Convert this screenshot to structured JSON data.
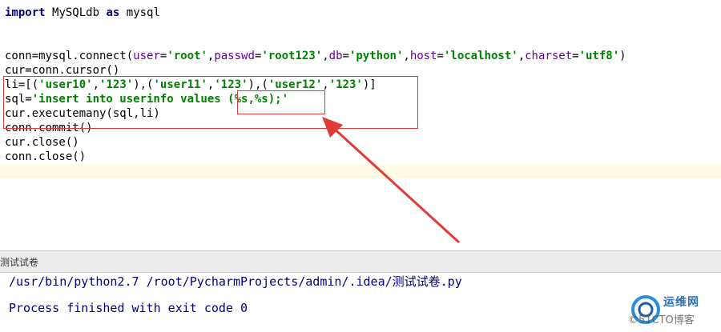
{
  "code": {
    "import_kw": "import",
    "import_module": "MySQLdb",
    "as_kw": "as",
    "import_alias": "mysql",
    "connect_prefix": "conn=mysql.connect(",
    "p_user": "user",
    "v_user": "'root'",
    "p_passwd": "passwd",
    "v_passwd": "'root123'",
    "p_db": "db",
    "v_db": "'python'",
    "p_host": "host",
    "v_host": "'localhost'",
    "p_charset": "charset",
    "v_charset": "'utf8'",
    "cursor_line": "cur=conn.cursor()",
    "li_prefix": "li=[(",
    "li_u10": "'user10'",
    "li_p1": "'123'",
    "li_u11": "'user11'",
    "li_p2": "'123'",
    "li_u12": "'user12'",
    "li_p3": "'123'",
    "sql_prefix": "sql=",
    "sql_value": "'insert into userinfo values (%s,%s);'",
    "executemany_line": "cur.executemany(sql,li)",
    "commit_line": "conn.commit()",
    "cur_close_line": "cur.close()",
    "conn_close_line": "conn.close()"
  },
  "run_panel": {
    "title": "测试试卷",
    "command": "/usr/bin/python2.7 /root/PycharmProjects/admin/.idea/测试试卷.py",
    "exit_message": "Process finished with exit code 0"
  },
  "watermark": {
    "top_text": "运维网",
    "bottom_text": "©51CTO博客"
  },
  "colors": {
    "keyword": "#000080",
    "string": "#008000",
    "param": "#660099",
    "annotation_red": "#e03a3a",
    "current_line": "#fffae3"
  }
}
